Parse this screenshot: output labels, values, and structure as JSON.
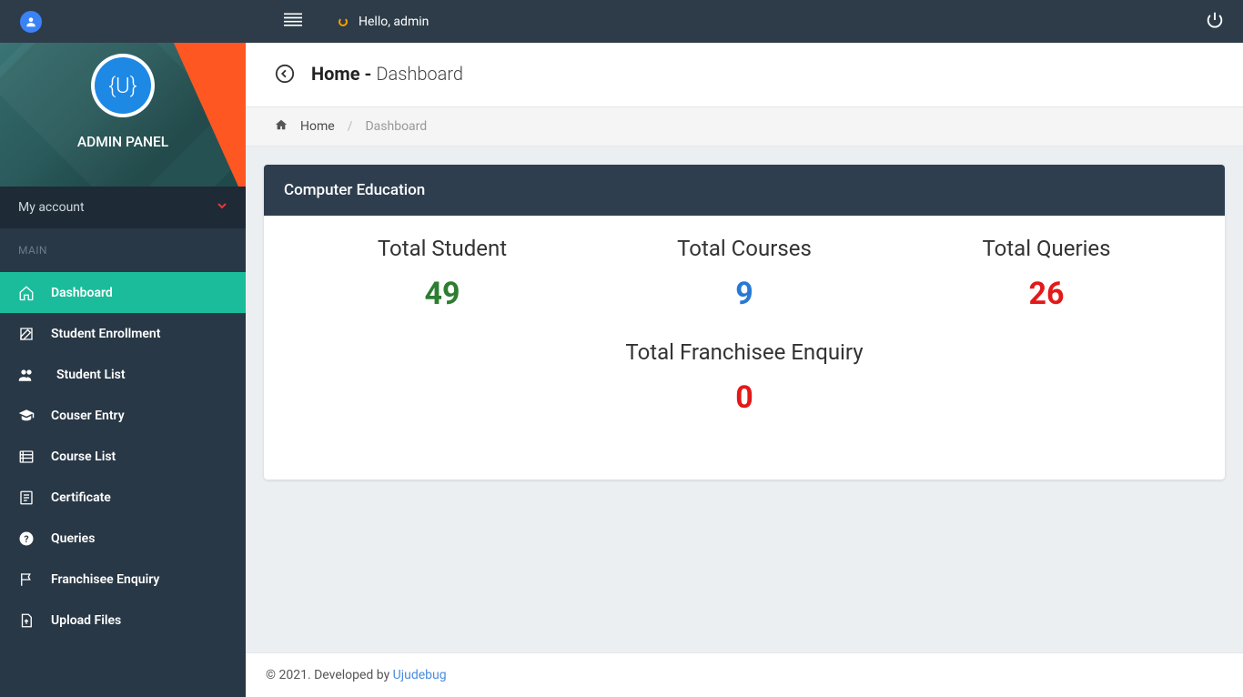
{
  "topbar": {
    "greeting": "Hello, admin"
  },
  "sidebar": {
    "title": "ADMIN PANEL",
    "logo_text": "{U}",
    "account_label": "My account",
    "section_label": "MAIN",
    "items": [
      {
        "label": "Dashboard",
        "icon": "home",
        "active": true
      },
      {
        "label": "Student Enrollment",
        "icon": "edit"
      },
      {
        "label": "Student List",
        "icon": "users",
        "indent": true
      },
      {
        "label": "Couser Entry",
        "icon": "gradcap"
      },
      {
        "label": "Course List",
        "icon": "list"
      },
      {
        "label": "Certificate",
        "icon": "document"
      },
      {
        "label": "Queries",
        "icon": "question"
      },
      {
        "label": "Franchisee Enquiry",
        "icon": "flag"
      },
      {
        "label": "Upload Files",
        "icon": "upload"
      }
    ]
  },
  "header": {
    "title_bold": "Home",
    "title_sep": " - ",
    "title_sub": "Dashboard"
  },
  "breadcrumb": {
    "home": "Home",
    "current": "Dashboard"
  },
  "card": {
    "title": "Computer Education",
    "stats": [
      {
        "label": "Total Student",
        "value": "49",
        "color": "green"
      },
      {
        "label": "Total Courses",
        "value": "9",
        "color": "blue"
      },
      {
        "label": "Total Queries",
        "value": "26",
        "color": "red"
      },
      {
        "label": "Total Franchisee Enquiry",
        "value": "0",
        "color": "red"
      }
    ]
  },
  "footer": {
    "text": "© 2021. Developed by ",
    "link": "Ujudebug"
  }
}
